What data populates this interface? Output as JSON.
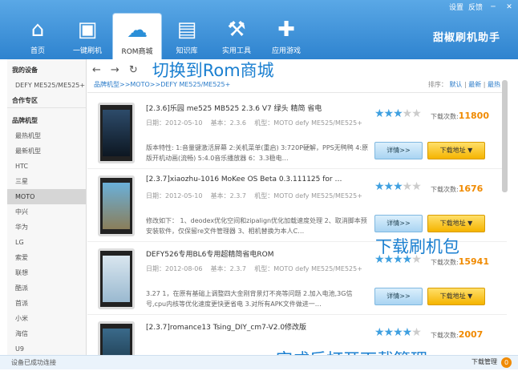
{
  "window": {
    "settings": "设置",
    "feedback": "反馈",
    "min": "─",
    "close": "✕"
  },
  "tabs": [
    {
      "label": "首页",
      "icon": "home-icon",
      "glyph": "⌂"
    },
    {
      "label": "一键刷机",
      "icon": "phone-icon",
      "glyph": "▣"
    },
    {
      "label": "ROM商城",
      "icon": "cloud-download-icon",
      "glyph": "☁"
    },
    {
      "label": "知识库",
      "icon": "book-icon",
      "glyph": "▤"
    },
    {
      "label": "实用工具",
      "icon": "tools-icon",
      "glyph": "⚒"
    },
    {
      "label": "应用游戏",
      "icon": "gamepad-icon",
      "glyph": "✚"
    }
  ],
  "brand": "甜椒刷机助手",
  "sidebar": {
    "my_device": "我的设备",
    "device": "DEFY ME525/ME525+",
    "coop": "合作专区",
    "brand_models": "品牌机型",
    "items": [
      "最热机型",
      "最新机型",
      "HTC",
      "三星",
      "MOTO",
      "中兴",
      "华为",
      "LG",
      "索爱",
      "联想",
      "酷派",
      "首派",
      "小米",
      "海信",
      "U9"
    ],
    "selected": "MOTO"
  },
  "nav": {
    "back": "←",
    "forward": "→",
    "refresh": "↻",
    "annotation": "切换到Rom商城"
  },
  "breadcrumb": {
    "path": "品牌机型>>MOTO>>DEFY ME525/ME525+",
    "sort_label": "排序：",
    "sort_default": "默认",
    "sort_new": "最新",
    "sort_hot": "最热"
  },
  "roms": [
    {
      "title": "[2.3.6]乐园 me525 MB525 2.3.6 V7 绿头 精简 省电",
      "date": "日期：2012-05-10",
      "ver": "基本：2.3.6",
      "model": "机型：MOTO defy ME525/ME525+",
      "desc": "版本特性: 1:音量键激活屏幕 2:关机菜单(重启) 3:720P硬解，PPS无鸭鸭 4:原版开机动画(流畅) 5:4.0音乐播放器 6：3.3稳电…",
      "count_label": "下载次数:",
      "count": "11800",
      "rating": 3
    },
    {
      "title": "[2.3.7]xiaozhu-1016 MoKee OS Beta 0.3.111125 for …",
      "date": "日期：2012-05-10",
      "ver": "基本：2.3.7",
      "model": "机型：MOTO defy ME525/ME525+",
      "desc": "修改如下： 1、deodex优化空间和zipalign优化加载速度处理 2、取消脚本预安装软件，仅保留re文件管理器 3、相机替换为本人C…",
      "count_label": "下载次数:",
      "count": "1676",
      "rating": 3
    },
    {
      "title": "DEFY526专用BL6专用超精简省电ROM",
      "date": "日期：2012-08-06",
      "ver": "基本：2.3.7",
      "model": "机型：MOTO defy ME525/ME525+",
      "desc": "3.27 1，在原有基础上调整四大金刚背景灯不亮等问题 2.加入电池,3G信号,cpu内核等优化速度更快更省电 3.对所有APK文件做进一…",
      "count_label": "下载次数:",
      "count": "15941",
      "rating": 4
    },
    {
      "title": "[2.3.7]romance13 Tsing_DIY_cm7-V2.0修改版",
      "date": "",
      "ver": "",
      "model": "",
      "desc": "",
      "count_label": "下载次数:",
      "count": "2007",
      "rating": 4
    }
  ],
  "buttons": {
    "detail": "详情>>",
    "download": "下载地址 ▼"
  },
  "annotations": {
    "download_pkg": "下载刷机包",
    "open_mgr": "完成后打开下载管理"
  },
  "status": {
    "connected": "设备已成功连接",
    "download_mgr": "下载管理",
    "badge": "0"
  }
}
